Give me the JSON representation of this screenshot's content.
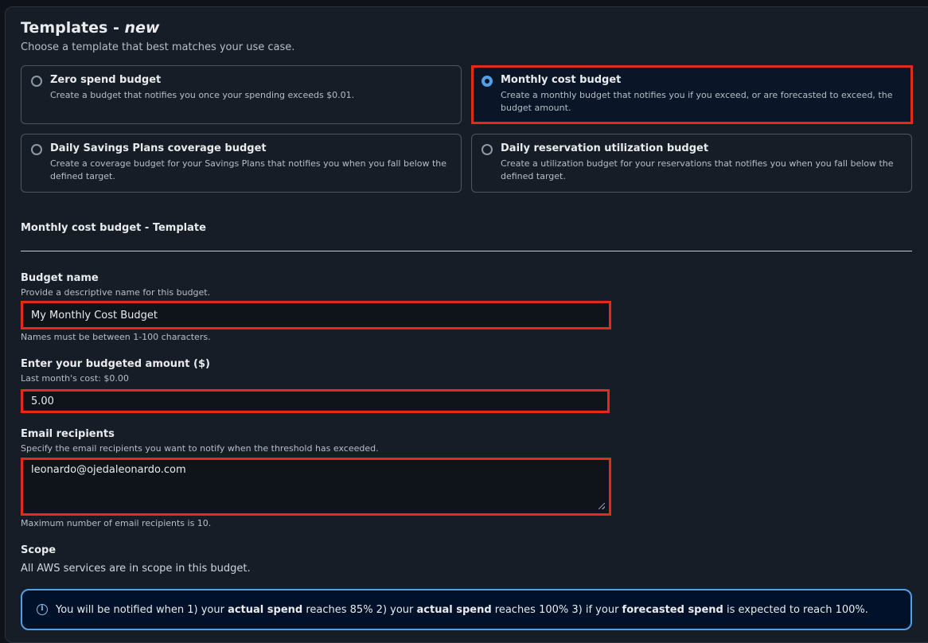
{
  "header": {
    "title": "Templates - ",
    "title_emphasis": "new",
    "description": "Choose a template that best matches your use case."
  },
  "templates": [
    {
      "title": "Zero spend budget",
      "description": "Create a budget that notifies you once your spending exceeds $0.01.",
      "selected": false
    },
    {
      "title": "Monthly cost budget",
      "description": "Create a monthly budget that notifies you if you exceed, or are forecasted to exceed, the budget amount.",
      "selected": true
    },
    {
      "title": "Daily Savings Plans coverage budget",
      "description": "Create a coverage budget for your Savings Plans that notifies you when you fall below the defined target.",
      "selected": false
    },
    {
      "title": "Daily reservation utilization budget",
      "description": "Create a utilization budget for your reservations that notifies you when you fall below the defined target.",
      "selected": false
    }
  ],
  "section": {
    "title": "Monthly cost budget - Template"
  },
  "budget_name": {
    "label": "Budget name",
    "description": "Provide a descriptive name for this budget.",
    "value": "My Monthly Cost Budget",
    "constraint": "Names must be between 1-100 characters."
  },
  "budget_amount": {
    "label": "Enter your budgeted amount ($)",
    "description": "Last month's cost: $0.00",
    "value": "5.00"
  },
  "email_recipients": {
    "label": "Email recipients",
    "description": "Specify the email recipients you want to notify when the threshold has exceeded.",
    "value": "leonardo@ojedaleonardo.com",
    "constraint": "Maximum number of email recipients is 10."
  },
  "scope": {
    "label": "Scope",
    "text": "All AWS services are in scope in this budget."
  },
  "alert": {
    "icon": "info-icon",
    "part1": "You will be notified when 1) your ",
    "bold1": "actual spend",
    "part2": " reaches 85% 2) your ",
    "bold2": "actual spend",
    "part3": " reaches 100% 3) if your ",
    "bold3": "forecasted spend",
    "part4": " is expected to reach 100%."
  },
  "colors": {
    "background": "#161d26",
    "highlight_border": "#e52a19",
    "accent_blue": "#539fe5"
  }
}
